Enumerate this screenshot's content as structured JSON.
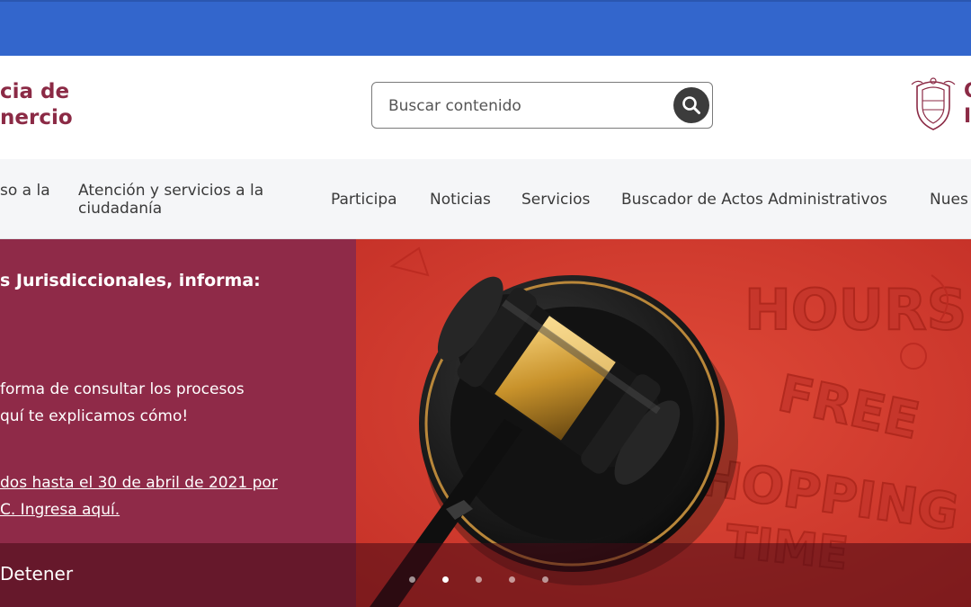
{
  "header": {
    "logo_line1": "cia de",
    "logo_line2": "nercio",
    "right_logo_line1": "C",
    "right_logo_line2": "I",
    "search": {
      "placeholder": "Buscar contenido"
    }
  },
  "nav": {
    "items": [
      {
        "line1": "so a la",
        "line2": ""
      },
      {
        "line1": "Atención y servicios a la",
        "line2": "ciudadanía"
      },
      {
        "line1": "Participa",
        "line2": ""
      },
      {
        "line1": "Noticias",
        "line2": ""
      },
      {
        "line1": "Servicios",
        "line2": ""
      },
      {
        "line1": "Buscador de Actos Administrativos",
        "line2": ""
      },
      {
        "line1": "Nues",
        "line2": ""
      }
    ]
  },
  "hero": {
    "title": "s Jurisdiccionales, informa:",
    "text_line1": " forma de consultar los procesos",
    "text_line2": "quí te explicamos cómo!",
    "link_line1": "dos hasta el 30 de abril de 2021 por",
    "link_line2": "C. Ingresa aquí.",
    "image_words": [
      "HOURS",
      "FREE",
      "HOPPING",
      "TIME"
    ],
    "stop_label": "Detener",
    "slides_total": 5,
    "active_slide": 2
  },
  "colors": {
    "topbar": "#3366cc",
    "brand": "#8b2a45",
    "hero_left": "#8f2a48",
    "hero_right": "#d43a2e"
  },
  "icons": {
    "search": "search-icon",
    "seal": "coat-of-arms-icon"
  }
}
